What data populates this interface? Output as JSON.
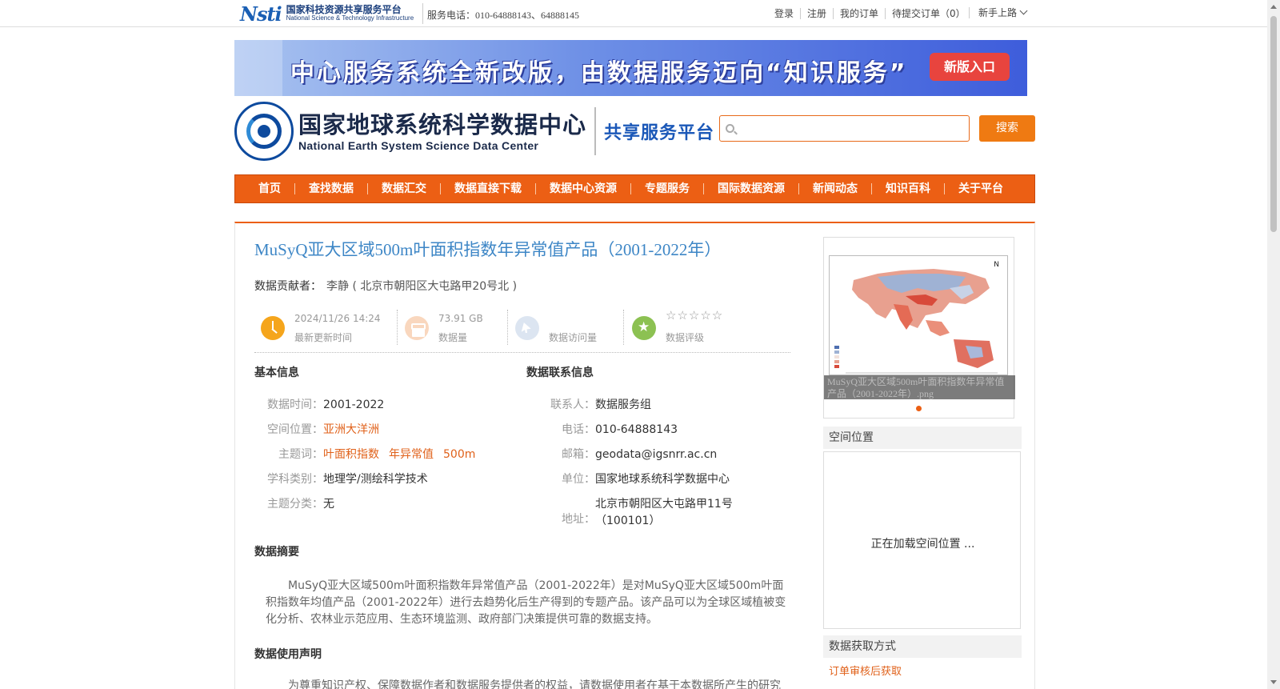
{
  "topbar": {
    "logo_mark": "Nsti",
    "logo_cn": "国家科技资源共享服务平台",
    "logo_en": "National Science & Technology Infrastructure",
    "hotline": "服务电话：010-64888143、64888145",
    "links": [
      "登录",
      "注册",
      "我的订单",
      "待提交订单（0）"
    ],
    "newbie": "新手上路"
  },
  "banner": {
    "text": "中心服务系统全新改版，由数据服务迈向“知识服务”",
    "button": "新版入口"
  },
  "header": {
    "org_cn": "国家地球系统科学数据中心",
    "org_en": "National Earth System Science Data Center",
    "platform": "共享服务平台",
    "search_placeholder": "",
    "search_button": "搜索"
  },
  "nav": [
    "首页",
    "查找数据",
    "数据汇交",
    "数据直接下载",
    "数据中心资源",
    "专题服务",
    "国际数据资源",
    "新闻动态",
    "知识百科",
    "关于平台"
  ],
  "dataset": {
    "title": "MuSyQ亚大区域500m叶面积指数年异常值产品（2001-2022年）",
    "contributor_label": "数据贡献者：",
    "contributor": "李静 ( 北京市朝阳区大屯路甲20号北 )",
    "stats": {
      "updated_value": "2024/11/26 14:24",
      "updated_label": "最新更新时间",
      "size_value": "73.91 GB",
      "size_label": "数据量",
      "visits_label": "数据访问量",
      "stars": "☆☆☆☆☆",
      "rating_label": "数据评级"
    }
  },
  "basic": {
    "heading": "基本信息",
    "time_k": "数据时间：",
    "time_v": "2001-2022",
    "space_k": "空间位置：",
    "space_v": "亚洲大洋洲",
    "keywords_k": "主题词：",
    "keywords": [
      "叶面积指数",
      "年异常值",
      "500m"
    ],
    "subject_k": "学科类别：",
    "subject_v": "地理学/测绘科学技术",
    "topic_k": "主题分类：",
    "topic_v": "无"
  },
  "contact": {
    "heading": "数据联系信息",
    "person_k": "联系人：",
    "person_v": "数据服务组",
    "phone_k": "电话：",
    "phone_v": "010-64888143",
    "email_k": "邮箱：",
    "email_v": "geodata@igsnrr.ac.cn",
    "unit_k": "单位：",
    "unit_v": "国家地球系统科学数据中心",
    "addr_k": "地址：",
    "addr_v1": "北京市朝阳区大屯路甲11号",
    "addr_v2": "（100101）"
  },
  "abstract": {
    "heading": "数据摘要",
    "text": "MuSyQ亚大区域500m叶面积指数年异常值产品（2001-2022年）是对MuSyQ亚大区域500m叶面积指数年均值产品（2001-2022年）进行去趋势化后生产得到的专题产品。该产品可以为全球区域植被变化分析、农林业示范应用、生态环境监测、政府部门决策提供可靠的数据支持。"
  },
  "declaration": {
    "heading": "数据使用声明",
    "text": "为尊重知识产权、保障数据作者和数据服务提供者的权益，请数据使用者在基于本数据所产生的研究"
  },
  "side": {
    "preview_caption": "MuSyQ亚大区域500m叶面积指数年异常值产品（2001-2022年）.png",
    "north": "N",
    "spatial_heading": "空间位置",
    "spatial_loading": "正在加载空间位置 ...",
    "access_heading": "数据获取方式",
    "access_link": "订单审核后获取"
  },
  "colors": {
    "accent": "#ec5f14",
    "title_blue": "#3d86c6",
    "link_orange": "#e0611a"
  }
}
